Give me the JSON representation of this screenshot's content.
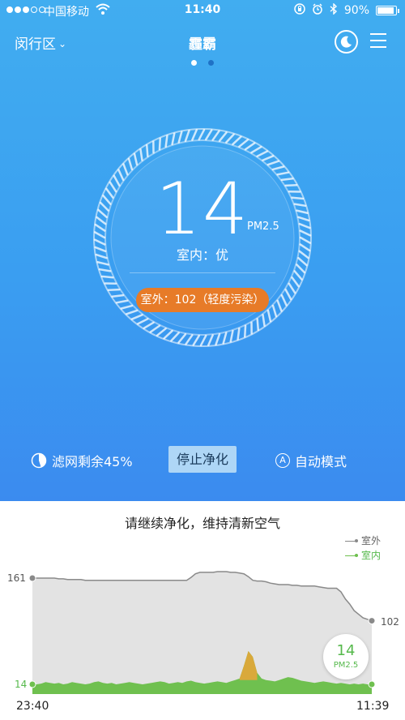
{
  "status_bar": {
    "carrier": "中国移动",
    "time": "11:40",
    "battery_text": "90%",
    "battery_level": 0.9
  },
  "nav": {
    "district": "闵行区",
    "title": "霾霸"
  },
  "pager": {
    "pages": 2,
    "active": 0
  },
  "reading": {
    "value": "14",
    "unit": "PM2.5",
    "indoor_text": "室内：优",
    "outdoor_text": "室外：102（轻度污染）"
  },
  "controls": {
    "filter_text": "滤网剩余45%",
    "filter_remaining": 0.45,
    "stop_label": "停止净化",
    "mode_label": "自动模式",
    "mode_icon_letter": "A"
  },
  "message": "请继续净化，维持清新空气",
  "legend": {
    "outdoor": "室外",
    "indoor": "室内"
  },
  "colors": {
    "outdoor_line": "#8a8a8a",
    "indoor_fill": "#6fc04f",
    "peak_fill": "#d9a93b",
    "outdoor_pill": "#e77b28"
  },
  "chart_data": {
    "type": "area",
    "x_start_label": "23:40",
    "x_end_label": "11:39",
    "y_start_label": "161",
    "y_end_label": "102",
    "indoor_start_label": "14",
    "indoor_current_value": "14",
    "indoor_current_unit": "PM2.5",
    "series": [
      {
        "name": "室外",
        "values": [
          161,
          161,
          161,
          161,
          161,
          161,
          160,
          160,
          159,
          159,
          159,
          159,
          158,
          158,
          158,
          158,
          158,
          158,
          158,
          158,
          158,
          158,
          158,
          158,
          158,
          158,
          158,
          158,
          158,
          158,
          158,
          158,
          158,
          158,
          158,
          158,
          162,
          167,
          169,
          169,
          169,
          169,
          170,
          170,
          170,
          169,
          169,
          168,
          167,
          163,
          158,
          157,
          157,
          156,
          154,
          153,
          152,
          152,
          152,
          151,
          151,
          150,
          150,
          150,
          150,
          149,
          148,
          147,
          147,
          147,
          142,
          132,
          125,
          116,
          111,
          106,
          104,
          102
        ]
      },
      {
        "name": "室内",
        "values": [
          14,
          14,
          15,
          17,
          16,
          15,
          16,
          14,
          15,
          17,
          16,
          15,
          14,
          15,
          17,
          18,
          16,
          15,
          16,
          14,
          15,
          16,
          17,
          16,
          15,
          14,
          15,
          16,
          17,
          18,
          17,
          15,
          16,
          17,
          16,
          18,
          19,
          17,
          16,
          15,
          16,
          17,
          18,
          17,
          16,
          18,
          20,
          22,
          40,
          60,
          52,
          30,
          22,
          20,
          19,
          18,
          20,
          22,
          24,
          23,
          21,
          19,
          18,
          17,
          16,
          17,
          18,
          17,
          16,
          15,
          16,
          15,
          14,
          15,
          14,
          15,
          14,
          14
        ]
      }
    ]
  }
}
